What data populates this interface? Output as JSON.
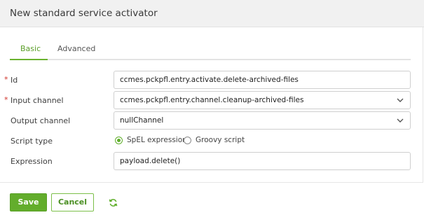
{
  "dialog": {
    "title": "New standard service activator"
  },
  "tabs": [
    {
      "label": "Basic",
      "active": true
    },
    {
      "label": "Advanced",
      "active": false
    }
  ],
  "form": {
    "id": {
      "label": "Id",
      "required": true,
      "value": "ccmes.pckpfl.entry.activate.delete-archived-files"
    },
    "input_channel": {
      "label": "Input channel",
      "required": true,
      "value": "ccmes.pckpfl.entry.channel.cleanup-archived-files"
    },
    "output_channel": {
      "label": "Output channel",
      "required": false,
      "value": "nullChannel"
    },
    "script_type": {
      "label": "Script type",
      "options": [
        {
          "label": "SpEL expression",
          "selected": true
        },
        {
          "label": "Groovy script",
          "selected": false
        }
      ]
    },
    "expression": {
      "label": "Expression",
      "value": "payload.delete()"
    }
  },
  "buttons": {
    "save": "Save",
    "cancel": "Cancel"
  },
  "icons": {
    "dropdown": "chevron-down-icon",
    "refresh": "refresh-icon"
  },
  "colors": {
    "accent": "#63ad2c",
    "required": "#d0342c"
  }
}
